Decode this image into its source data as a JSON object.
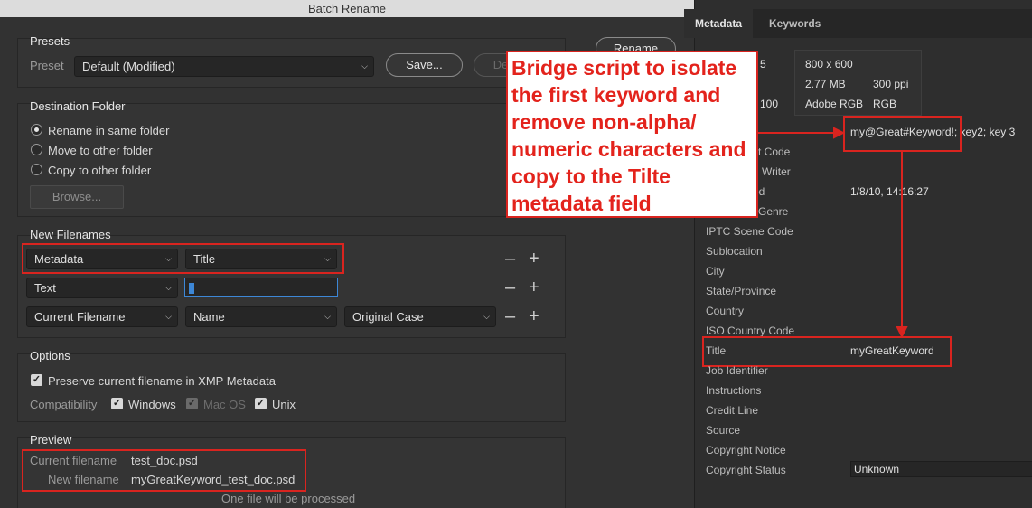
{
  "dialog": {
    "title": "Batch Rename",
    "rename_button": "Rename",
    "presets": {
      "group_label": "Presets",
      "preset_label": "Preset",
      "preset_value": "Default (Modified)",
      "save_button": "Save...",
      "delete_button": "De"
    },
    "destination": {
      "group_label": "Destination Folder",
      "options": [
        "Rename in same folder",
        "Move to other folder",
        "Copy to other folder"
      ],
      "selected_index": 0,
      "browse_button": "Browse..."
    },
    "new_filenames": {
      "group_label": "New Filenames",
      "rows": [
        {
          "type": "Metadata",
          "field": "Title"
        },
        {
          "type": "Text",
          "field": ""
        },
        {
          "type": "Current Filename",
          "field": "Name",
          "extra": "Original Case"
        }
      ]
    },
    "options": {
      "group_label": "Options",
      "preserve_label": "Preserve current filename in XMP Metadata",
      "compat_label": "Compatibility",
      "windows": "Windows",
      "macos": "Mac OS",
      "unix": "Unix"
    },
    "preview": {
      "group_label": "Preview",
      "current_label": "Current filename",
      "current_value": "test_doc.psd",
      "new_label": "New filename",
      "new_value": "myGreatKeyword_test_doc.psd",
      "status": "One file will be processed"
    }
  },
  "panel": {
    "tabs": [
      "Metadata",
      "Keywords"
    ],
    "info": {
      "dimensions": "800 x 600",
      "size": "2.77 MB",
      "resolution": "300 ppi",
      "profile": "Adobe RGB",
      "mode": "RGB",
      "left_partial_top": "5",
      "left_partial_bottom": "100"
    },
    "keywords_value": "my@Great#Keyword!; key2; key 3",
    "date_value": "1/8/10, 14:16:27",
    "fields": [
      "ct Code",
      "n Writer",
      "ed",
      "l Genre",
      "IPTC Scene Code",
      "Sublocation",
      "City",
      "State/Province",
      "Country",
      "ISO Country Code",
      "Title",
      "Job Identifier",
      "Instructions",
      "Credit Line",
      "Source",
      "Copyright Notice",
      "Copyright Status"
    ],
    "title_value": "myGreatKeyword",
    "copyright_status_value": "Unknown"
  },
  "callout": {
    "text": "Bridge script to isolate the first keyword and remove non-alpha/ numeric characters and copy to the Tilte metadata field"
  },
  "colors": {
    "annotation_red": "#d9241f",
    "focus_blue": "#3d87d6"
  }
}
